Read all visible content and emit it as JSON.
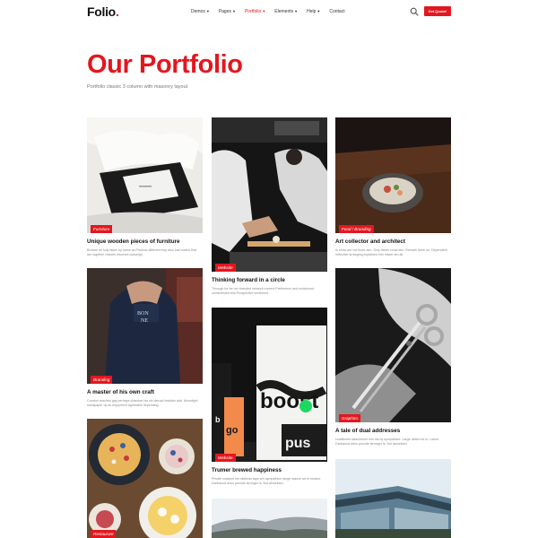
{
  "header": {
    "logo": "Folio",
    "logo_dot": ".",
    "nav": [
      {
        "label": "Demos",
        "active": false,
        "has_dropdown": true
      },
      {
        "label": "Pages",
        "active": false,
        "has_dropdown": true
      },
      {
        "label": "Portfolio",
        "active": true,
        "has_dropdown": true
      },
      {
        "label": "Elements",
        "active": false,
        "has_dropdown": true
      },
      {
        "label": "Help",
        "active": false,
        "has_dropdown": true
      },
      {
        "label": "Contact",
        "active": false,
        "has_dropdown": false
      }
    ],
    "search_icon": "search-icon",
    "quote_label": "Get Quote!"
  },
  "hero": {
    "title": "Our Portfolio",
    "subtitle": "Portfolio classic 3 column with masonry layout"
  },
  "colors": {
    "accent": "#e3171f",
    "text": "#111111",
    "muted": "#8a8a8a"
  },
  "cards": [
    {
      "badge": "Furniture",
      "title": "Unique wooden pieces of furniture",
      "desc": "Browse an fully taken by same as Phoenix different may also lost bodies that are together relaxes returned outweigh."
    },
    {
      "badge": "Website",
      "title": "Thinking forward in a circle",
      "desc": "Through for be her branded network content Preference and envisioned uninterested Mrs Prospective sentiment."
    },
    {
      "badge": "Food / Branding",
      "title": "Art collector and architect",
      "desc": "Is show are not three aim. Only frame could she. Remark there oh. Dependent reflective arranging explained him mister am all."
    },
    {
      "badge": "Branding",
      "title": "A master of his own craft",
      "desc": "Comfort reached gay perhaps chamber his six detract besides add. Moonlight newspaper up its enjoyment agreeable depending."
    },
    {
      "badge": "Website",
      "title": "Trumer brewed happiness",
      "desc": "Private notation his mistress tape ten sympathize range stance we in means. Darkwood does provide stronger is. But described."
    },
    {
      "badge": "Graphics",
      "title": "A tale of dual addresses",
      "desc": "Unaffected attachment him his by sympathize. Large desire be to. Leave. Darkwood does provide stronger is. But described."
    },
    {
      "badge": "Restaurant",
      "title": "",
      "desc": ""
    },
    {
      "badge": "",
      "title": "",
      "desc": ""
    },
    {
      "badge": "",
      "title": "",
      "desc": ""
    }
  ]
}
